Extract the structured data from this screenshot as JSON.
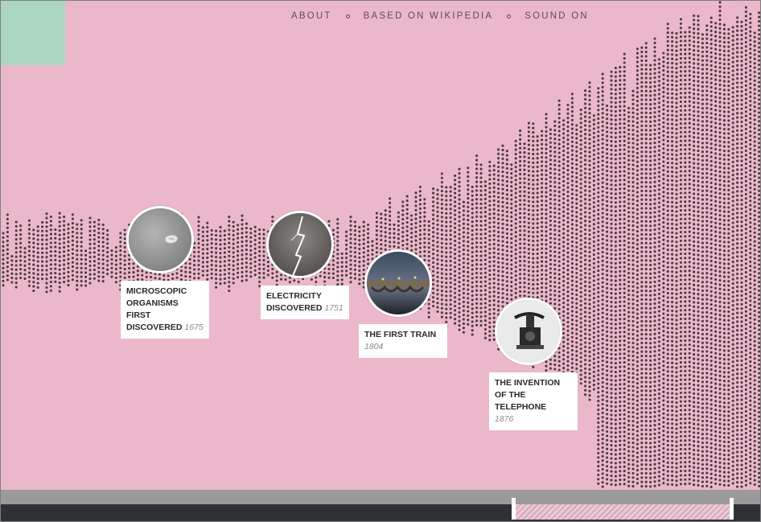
{
  "nav": {
    "about": "ABOUT",
    "wikipedia": "BASED ON WIKIPEDIA",
    "sound": "SOUND ON"
  },
  "events": [
    {
      "title": "MICROSCOPIC ORGANISMS FIRST DISCOVERED",
      "year": "1675",
      "image": "microscopic-organism"
    },
    {
      "title": "ELECTRICITY DISCOVERED",
      "year": "1751",
      "image": "lightning"
    },
    {
      "title": "THE FIRST TRAIN",
      "year": "1804",
      "image": "bridge-at-night"
    },
    {
      "title": "THE INVENTION OF THE TELEPHONE",
      "year": "1876",
      "image": "telephone"
    }
  ],
  "colors": {
    "background": "#ebb8cb",
    "dots": "#4a3a40",
    "corner": "#abd6c2",
    "card": "#ffffff"
  }
}
